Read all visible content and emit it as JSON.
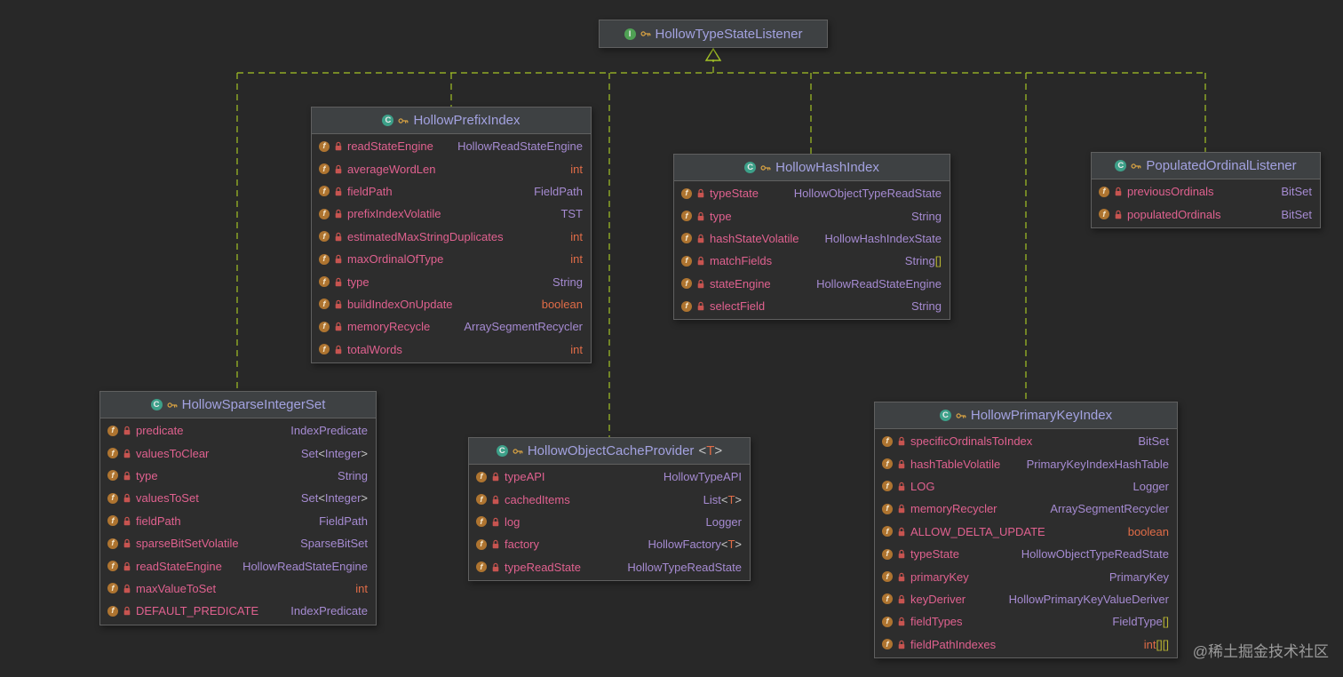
{
  "colors": {
    "canvas_bg": "#282828",
    "box_body_bg": "#2D2D2D",
    "box_header_bg": "#3E4143",
    "box_border": "#606060",
    "title_color": "#A3A2E0",
    "field_name_color": "#E0618F",
    "type_class_color": "#A68BD2",
    "type_primitive_color": "#E06C47",
    "bracket_square_color": "#B8B332",
    "bracket_angle_color": "#C8C8C8",
    "connector_color": "#A4C326",
    "class_icon_color": "#3DA089",
    "interface_icon_color": "#4FA154",
    "field_icon_color": "#AE7430",
    "lock_icon_color": "#C75450",
    "key_icon_color": "#D9A343",
    "watermark_color": "#9B9B9B"
  },
  "icons": {
    "class_letter": "C",
    "interface_letter": "I",
    "field_letter": "f"
  },
  "nodes": [
    {
      "id": "listener",
      "kind": "interface",
      "title": "HollowTypeStateListener",
      "fields": []
    },
    {
      "id": "prefix",
      "kind": "class",
      "title": "HollowPrefixIndex",
      "fields": [
        {
          "name": "readStateEngine",
          "type": "HollowReadStateEngine"
        },
        {
          "name": "averageWordLen",
          "type": "int"
        },
        {
          "name": "fieldPath",
          "type": "FieldPath"
        },
        {
          "name": "prefixIndexVolatile",
          "type": "TST"
        },
        {
          "name": "estimatedMaxStringDuplicates",
          "type": "int"
        },
        {
          "name": "maxOrdinalOfType",
          "type": "int"
        },
        {
          "name": "type",
          "type": "String"
        },
        {
          "name": "buildIndexOnUpdate",
          "type": "boolean"
        },
        {
          "name": "memoryRecycle",
          "type": "ArraySegmentRecycler"
        },
        {
          "name": "totalWords",
          "type": "int"
        }
      ]
    },
    {
      "id": "hash",
      "kind": "class",
      "title": "HollowHashIndex",
      "fields": [
        {
          "name": "typeState",
          "type": "HollowObjectTypeReadState"
        },
        {
          "name": "type",
          "type": "String"
        },
        {
          "name": "hashStateVolatile",
          "type": "HollowHashIndexState"
        },
        {
          "name": "matchFields",
          "type": "String[]"
        },
        {
          "name": "stateEngine",
          "type": "HollowReadStateEngine"
        },
        {
          "name": "selectField",
          "type": "String"
        }
      ]
    },
    {
      "id": "populated",
      "kind": "class",
      "title": "PopulatedOrdinalListener",
      "fields": [
        {
          "name": "previousOrdinals",
          "type": "BitSet"
        },
        {
          "name": "populatedOrdinals",
          "type": "BitSet"
        }
      ]
    },
    {
      "id": "sparse",
      "kind": "class",
      "title": "HollowSparseIntegerSet",
      "fields": [
        {
          "name": "predicate",
          "type": "IndexPredicate"
        },
        {
          "name": "valuesToClear",
          "type": "Set<Integer>"
        },
        {
          "name": "type",
          "type": "String"
        },
        {
          "name": "valuesToSet",
          "type": "Set<Integer>"
        },
        {
          "name": "fieldPath",
          "type": "FieldPath"
        },
        {
          "name": "sparseBitSetVolatile",
          "type": "SparseBitSet"
        },
        {
          "name": "readStateEngine",
          "type": "HollowReadStateEngine"
        },
        {
          "name": "maxValueToSet",
          "type": "int"
        },
        {
          "name": "DEFAULT_PREDICATE",
          "type": "IndexPredicate"
        }
      ]
    },
    {
      "id": "provider",
      "kind": "class",
      "title": "HollowObjectCacheProvider",
      "generic": "<T>",
      "fields": [
        {
          "name": "typeAPI",
          "type": "HollowTypeAPI"
        },
        {
          "name": "cachedItems",
          "type": "List<T>"
        },
        {
          "name": "log",
          "type": "Logger"
        },
        {
          "name": "factory",
          "type": "HollowFactory<T>"
        },
        {
          "name": "typeReadState",
          "type": "HollowTypeReadState"
        }
      ]
    },
    {
      "id": "pki",
      "kind": "class",
      "title": "HollowPrimaryKeyIndex",
      "fields": [
        {
          "name": "specificOrdinalsToIndex",
          "type": "BitSet"
        },
        {
          "name": "hashTableVolatile",
          "type": "PrimaryKeyIndexHashTable"
        },
        {
          "name": "LOG",
          "type": "Logger"
        },
        {
          "name": "memoryRecycler",
          "type": "ArraySegmentRecycler"
        },
        {
          "name": "ALLOW_DELTA_UPDATE",
          "type": "boolean"
        },
        {
          "name": "typeState",
          "type": "HollowObjectTypeReadState"
        },
        {
          "name": "primaryKey",
          "type": "PrimaryKey"
        },
        {
          "name": "keyDeriver",
          "type": "HollowPrimaryKeyValueDeriver"
        },
        {
          "name": "fieldTypes",
          "type": "FieldType[]"
        },
        {
          "name": "fieldPathIndexes",
          "type": "int[][]"
        }
      ]
    }
  ],
  "edges": [
    {
      "from": "HollowPrefixIndex",
      "to": "HollowTypeStateListener",
      "style": "dashed",
      "type": "realization"
    },
    {
      "from": "HollowHashIndex",
      "to": "HollowTypeStateListener",
      "style": "dashed",
      "type": "realization"
    },
    {
      "from": "PopulatedOrdinalListener",
      "to": "HollowTypeStateListener",
      "style": "dashed",
      "type": "realization"
    },
    {
      "from": "HollowSparseIntegerSet",
      "to": "HollowTypeStateListener",
      "style": "dashed",
      "type": "realization"
    },
    {
      "from": "HollowObjectCacheProvider",
      "to": "HollowTypeStateListener",
      "style": "dashed",
      "type": "realization"
    },
    {
      "from": "HollowPrimaryKeyIndex",
      "to": "HollowTypeStateListener",
      "style": "dashed",
      "type": "realization"
    }
  ],
  "watermark": "@稀土掘金技术社区"
}
